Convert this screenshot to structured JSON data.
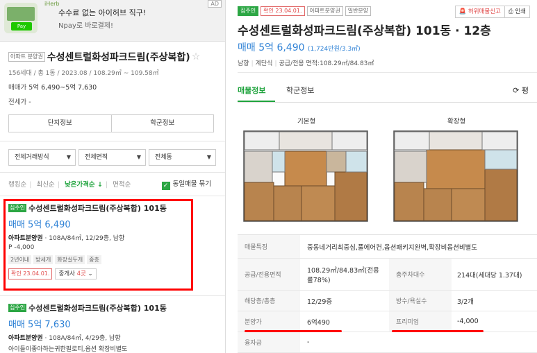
{
  "ad": {
    "brand": "iHerb",
    "title": "수수료 없는 아이허브 직구!",
    "subtitle": "Npay로 바로결제!",
    "pay_label": "Pay",
    "mark": "AD"
  },
  "complex": {
    "tag": "아파트 분양권",
    "title": "수성센트럴화성파크드림(주상복합)",
    "meta": "156세대 / 총 1동 / 2023.08 / 108.29㎡ ~ 109.58㎡",
    "price_label": "매매가",
    "price_value": "5억 6,490~5억 7,630",
    "jeonse": "전세가 -",
    "btn_info": "단지정보",
    "btn_school": "학군정보"
  },
  "filters": [
    {
      "label": "전체거래방식"
    },
    {
      "label": "전체면적"
    },
    {
      "label": "전체동"
    }
  ],
  "sort": {
    "rank": "랭킹순",
    "recent": "최신순",
    "low_price": "낮은가격순 ↓",
    "area": "면적순",
    "same_listing": "동일매물 묶기"
  },
  "listings": [
    {
      "badge": "집주인",
      "title": "수성센트럴화성파크드림(주상복합) 101동",
      "price": "매매 5억 6,490",
      "type": "아파트분양권",
      "detail": " · 108A/84㎡, 12/29층, 남향",
      "sub": "P -4,000",
      "chips": [
        "2년이내",
        "방세개",
        "화장실두개",
        "중층"
      ],
      "confirm": "확인 23.04.01.",
      "broker": "중개사",
      "broker_count": "4곳"
    },
    {
      "badge": "집주인",
      "title": "수성센트럴화성파크드림(주상복합) 101동",
      "price": "매매 5억 7,630",
      "type": "아파트분양권",
      "detail": " · 108A/84㎡, 4/29층, 남향",
      "sub": "아이들이좋아하는귀한필로티,옵션 확장비별도"
    }
  ],
  "detail": {
    "badges": {
      "owner": "집주인",
      "confirm": "확인 23.04.01.",
      "type": "아파트분양권",
      "sale": "일반분양"
    },
    "report": "허위매물신고",
    "print": "인쇄",
    "title": "수성센트럴화성파크드림(주상복합) 101동 · 12층",
    "price": "매매 5억 6,490",
    "price_per": "(1,724만원/3.3㎡)",
    "meta": [
      "남향",
      "계단식",
      "공급/전용 면적:108.29㎡/84.83㎡"
    ],
    "tabs": {
      "listing": "매물정보",
      "school": "학군정보"
    },
    "refresh": "평",
    "plan_basic": "기본형",
    "plan_extended": "확장형",
    "rows": {
      "feature_h": "매물특징",
      "feature_v": "중동네거리최중심,풀에어컨,옵션패키지완벽,확장비옵션비별도",
      "area_h": "공급/전용면적",
      "area_v": "108.29㎡/84.83㎡(전용률78%)",
      "households_h": "총주차대수",
      "households_v": "214대(세대당 1.37대)",
      "floor_h": "해당층/총층",
      "floor_v": "12/29층",
      "rooms_h": "방수/욕실수",
      "rooms_v": "3/2개",
      "presale_h": "분양가",
      "presale_v": "6억490",
      "premium_h": "프리미엄",
      "premium_v": "-4,000",
      "loan_h": "융자금",
      "loan_v": "-"
    }
  },
  "colors": {
    "accent_green": "#1ea33c",
    "price_blue": "#2f82d6",
    "highlight_red": "#ff0000"
  }
}
